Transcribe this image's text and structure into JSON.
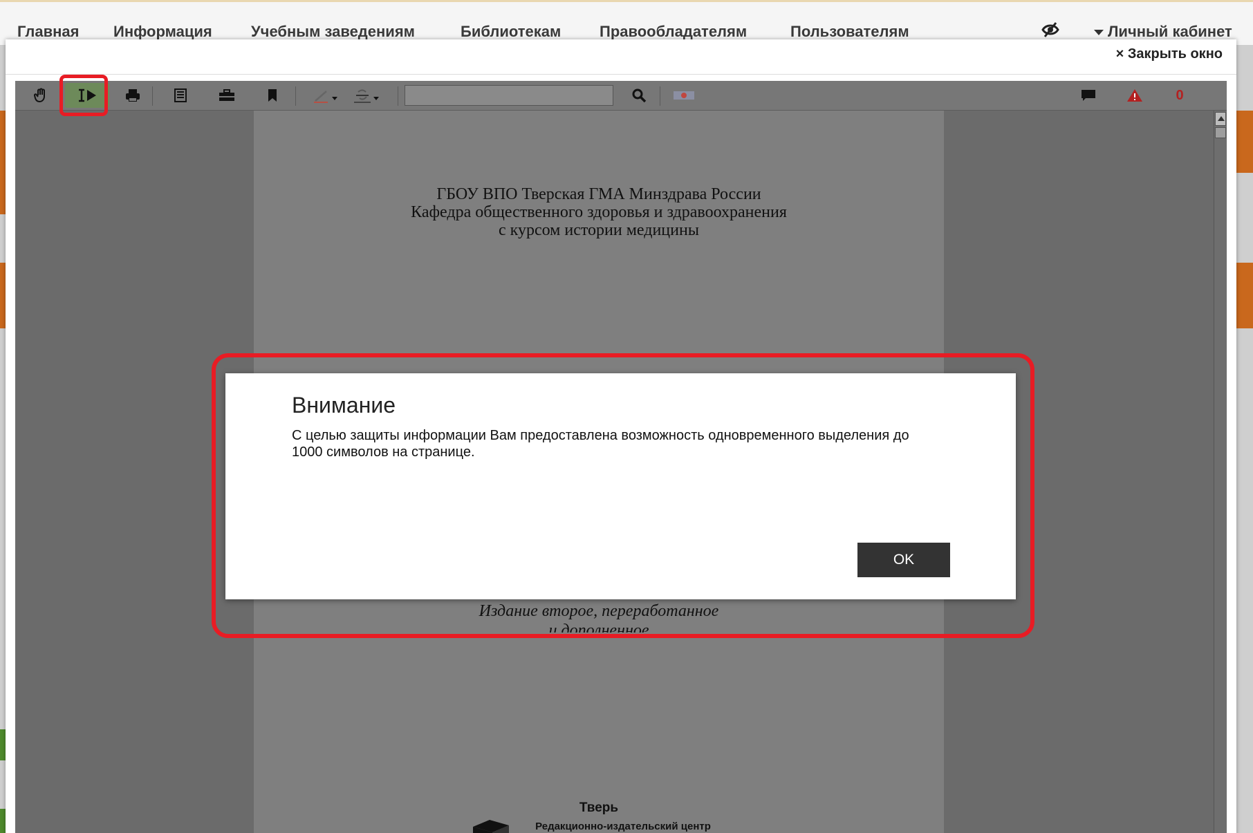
{
  "site_nav": {
    "items": [
      {
        "label": "Главная"
      },
      {
        "label": "Информация"
      },
      {
        "label": "Учебным заведениям"
      },
      {
        "label": "Библиотекам"
      },
      {
        "label": "Правообладателям"
      },
      {
        "label": "Пользователям"
      }
    ],
    "cabinet_label": "Личный кабинет"
  },
  "window": {
    "close_label": "× Закрыть окно"
  },
  "toolbar": {
    "search_value": "",
    "alert_count": "0",
    "icons": [
      "hand-icon",
      "text-select-icon",
      "print-icon",
      "document-icon",
      "briefcase-icon",
      "bookmark-icon",
      "pen-icon",
      "strikethrough-icon",
      "search-icon",
      "flag-icon",
      "comment-icon",
      "warning-icon"
    ]
  },
  "document": {
    "header_lines": [
      "ГБОУ ВПО Тверская ГМА Минздрава России",
      "Кафедра общественного здоровья и здравоохранения",
      "с курсом истории медицины"
    ],
    "edition_line1": "Издание второе, переработанное",
    "edition_line2": "и дополненное",
    "city": "Тверь",
    "publisher": "Редакционно-издательский центр"
  },
  "dialog": {
    "title": "Внимание",
    "message": "С целью защиты информации Вам предоставлена возможность одновременного выделения до 1000 символов на странице.",
    "ok_label": "OK"
  },
  "colors": {
    "highlight_outline": "#e81c24",
    "active_tool_bg": "#6d8a5a",
    "ok_button_bg": "#333333"
  }
}
